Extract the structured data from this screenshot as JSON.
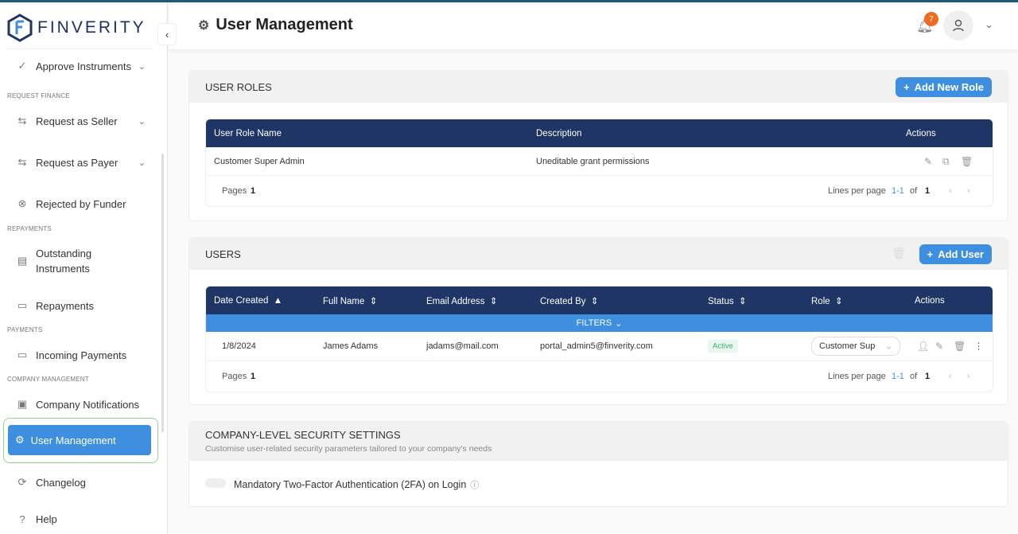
{
  "brand": {
    "name": "FINVERITY"
  },
  "sidebar": {
    "items": [
      {
        "label": "Approve Instruments"
      },
      {
        "label": "Request as Seller"
      },
      {
        "label": "Request as Payer"
      },
      {
        "label": "Rejected by Funder"
      },
      {
        "label": "Outstanding Instruments"
      },
      {
        "label": "Repayments"
      },
      {
        "label": "Incoming Payments"
      },
      {
        "label": "Company Notifications"
      },
      {
        "label": "User Management"
      },
      {
        "label": "Changelog"
      },
      {
        "label": "Help"
      }
    ],
    "sections": [
      "REQUEST FINANCE",
      "REPAYMENTS",
      "PAYMENTS",
      "COMPANY MANAGEMENT"
    ]
  },
  "header": {
    "title": "User Management",
    "notification_count": "7"
  },
  "roles": {
    "title": "USER ROLES",
    "add_label": "Add New Role",
    "columns": [
      "User Role Name",
      "Description",
      "Actions"
    ],
    "rows": [
      {
        "name": "Customer Super Admin",
        "description": "Uneditable grant permissions"
      }
    ],
    "pager": {
      "pages_label": "Pages",
      "pages": "1",
      "lines_label": "Lines per page",
      "range": "1-1",
      "of": "of",
      "total": "1"
    }
  },
  "users": {
    "title": "USERS",
    "add_label": "Add User",
    "columns": [
      "Date Created",
      "Full Name",
      "Email Address",
      "Created By",
      "Status",
      "Role",
      "Actions"
    ],
    "filters_label": "FILTERS",
    "rows": [
      {
        "date": "1/8/2024",
        "name": "James Adams",
        "email": "jadams@mail.com",
        "created_by": "portal_admin5@finverity.com",
        "status": "Active",
        "role": "Customer Sup"
      }
    ],
    "pager": {
      "pages_label": "Pages",
      "pages": "1",
      "lines_label": "Lines per page",
      "range": "1-1",
      "of": "of",
      "total": "1"
    }
  },
  "security": {
    "title": "COMPANY-LEVEL SECURITY SETTINGS",
    "subtitle": "Customise user-related security parameters tailored to your company's needs",
    "twofa_label": "Mandatory Two-Factor Authentication (2FA) on Login",
    "twofa_enabled": false
  }
}
